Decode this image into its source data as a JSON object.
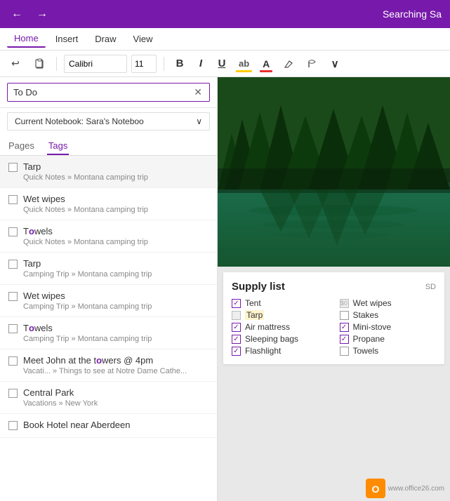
{
  "titlebar": {
    "back_label": "←",
    "forward_label": "→",
    "title": "Searching Sa"
  },
  "menubar": {
    "items": [
      {
        "label": "Home",
        "active": true
      },
      {
        "label": "Insert"
      },
      {
        "label": "Draw"
      },
      {
        "label": "View"
      }
    ]
  },
  "toolbar": {
    "undo_label": "↩",
    "clipboard_label": "📋",
    "font_value": "Calibri",
    "font_size_value": "11",
    "bold_label": "B",
    "italic_label": "I",
    "underline_label": "U",
    "highlight_label": "ab",
    "font_color_label": "A",
    "eraser_label": "🖊",
    "format_label": "A",
    "more_label": "∨"
  },
  "search": {
    "value": "To Do",
    "clear_label": "✕",
    "notebook_label": "Current Notebook: Sara's Noteboo",
    "notebook_arrow": "∨"
  },
  "tabs": {
    "pages": "Pages",
    "tags": "Tags",
    "active": "tags"
  },
  "results": [
    {
      "title": "Tarp",
      "path": "Quick Notes » Montana camping trip",
      "checked": false,
      "selected": true,
      "highlight": ""
    },
    {
      "title": "Wet wipes",
      "path": "Quick Notes » Montana camping trip",
      "checked": false,
      "selected": false,
      "highlight": ""
    },
    {
      "title_parts": [
        "T",
        "o",
        "wels"
      ],
      "title": "Towels",
      "path": "Quick Notes » Montana camping trip",
      "checked": false,
      "selected": false,
      "highlight": "o",
      "highlight_start": 1,
      "highlight_len": 1
    },
    {
      "title": "Tarp",
      "path": "Camping Trip » Montana camping trip",
      "checked": false,
      "selected": false,
      "highlight": ""
    },
    {
      "title": "Wet wipes",
      "path": "Camping Trip » Montana camping trip",
      "checked": false,
      "selected": false,
      "highlight": ""
    },
    {
      "title": "Towels",
      "path": "Camping Trip » Montana camping trip",
      "checked": false,
      "selected": false,
      "highlight_o": true
    },
    {
      "title": "Meet John at the towers @ 4pm",
      "path": "Vacati... » Things to see at Notre Dame Cathe...",
      "checked": false,
      "selected": false,
      "highlight_towers": true
    },
    {
      "title": "Central Park",
      "path": "Vacations » New York",
      "checked": false,
      "selected": false
    },
    {
      "title": "Book Hotel near Aberdeen",
      "path": "",
      "checked": false,
      "selected": false
    }
  ],
  "supply_card": {
    "title": "Supply list",
    "items_col1": [
      {
        "label": "Tent",
        "checked": true,
        "strikethrough": false
      },
      {
        "label": "Tarp",
        "checked": false,
        "strikethrough": false,
        "partial": true
      },
      {
        "label": "Air mattress",
        "checked": true,
        "strikethrough": false
      },
      {
        "label": "Sleeping bags",
        "checked": true,
        "strikethrough": false
      },
      {
        "label": "Flashlight",
        "checked": true,
        "strikethrough": false
      }
    ],
    "items_col2": [
      {
        "label": "Wet wipes",
        "checked": false,
        "strikethrough": false,
        "partial": true
      },
      {
        "label": "Stakes",
        "checked": false,
        "strikethrough": false
      },
      {
        "label": "Mini-stove",
        "checked": true,
        "strikethrough": false
      },
      {
        "label": "Propane",
        "checked": true,
        "strikethrough": false
      },
      {
        "label": "Towels",
        "checked": false,
        "strikethrough": false
      }
    ]
  },
  "watermark": {
    "site": "www.office26.com"
  }
}
